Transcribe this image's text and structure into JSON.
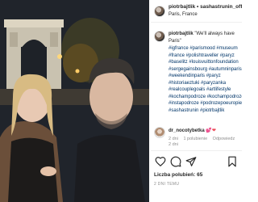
{
  "post_header": {
    "usernames": "piotrbajtlik • sashastrunin_official",
    "location": "Paris, France"
  },
  "caption": {
    "username": "piotrbajtlik",
    "text": "\"We'll always have Paris\"",
    "hashtags": [
      "#igfrance #parismood #museum",
      "#france #polishtraveller #paryz",
      "#baselitz #louisvuittonfoundation",
      "#sergegainsbourg #autumninparis",
      "#weekendinparis #paryz",
      "#historiaeztuki #paryzanka",
      "#realcouplegoals #artlifestyle",
      "#kochampodroze #kochampodroze",
      "#instapodroze #podrozepoeuropie",
      "#sashastrunin #piotrbajtlik"
    ],
    "timestamp": "2 dni"
  },
  "comment": {
    "username": "dr_nocotybetka",
    "hearts": "💕❤",
    "age": "2 dni",
    "likes": "1 polubienie",
    "reply": "Odpowiedz"
  },
  "actions": {
    "like_icon": "heart-icon",
    "comment_icon": "comment-bubble-icon",
    "share_icon": "paper-plane-icon",
    "save_icon": "bookmark-icon"
  },
  "likes": {
    "label": "Liczba polubień:",
    "count": "65"
  },
  "post_date": "2 DNI TEMU",
  "colors": {
    "link": "#003569",
    "muted": "#8e8e8e",
    "heart": "#ed4956"
  }
}
